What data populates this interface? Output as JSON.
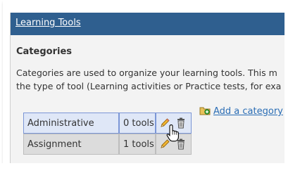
{
  "header": {
    "title": "Learning Tools"
  },
  "section": {
    "title": "Categories",
    "description_lines": [
      "Categories are used to organize your learning tools. This m",
      "the type of tool (Learning activities or Practice tests, for exa"
    ]
  },
  "actions": {
    "add_category": "Add a category"
  },
  "categories": [
    {
      "name": "Administrative",
      "count": "0 tools"
    },
    {
      "name": "Assignment",
      "count": "1 tools"
    }
  ],
  "icons": {
    "add": "add-category-icon",
    "edit": "pencil-icon",
    "delete": "trash-icon",
    "cursor": "hand-pointer-icon"
  },
  "colors": {
    "header_bg": "#2f5f8f",
    "link": "#2a6db5",
    "row_highlight": "#dfe7f7",
    "row_plain": "#dcdcdc"
  }
}
